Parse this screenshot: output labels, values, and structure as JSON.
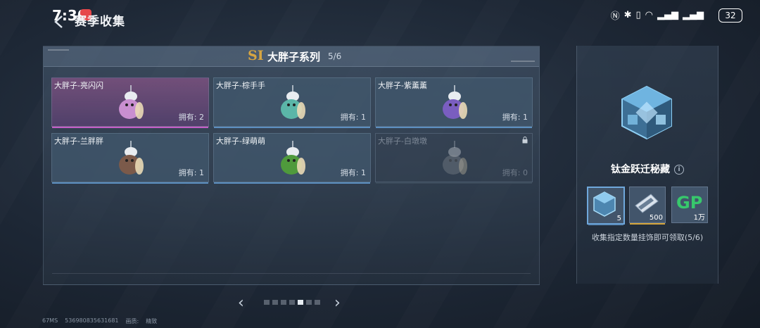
{
  "status_bar": {
    "time": "7:30",
    "battery": "32"
  },
  "header": {
    "title": "赛季收集"
  },
  "series": {
    "badge": "SI",
    "title": "大胖子系列",
    "progress": "5/6"
  },
  "cards": [
    {
      "name": "大胖子-亮闪闪",
      "owned": "拥有: 2",
      "state": "highlight",
      "color": "#c98fd0"
    },
    {
      "name": "大胖子-棕手手",
      "owned": "拥有: 1",
      "state": "normal",
      "color": "#5bb6a8"
    },
    {
      "name": "大胖子-紫薰薰",
      "owned": "拥有: 1",
      "state": "normal",
      "color": "#7a5ec0"
    },
    {
      "name": "大胖子-兰胖胖",
      "owned": "拥有: 1",
      "state": "normal",
      "color": "#7b5a4a"
    },
    {
      "name": "大胖子-绿萌萌",
      "owned": "拥有: 1",
      "state": "normal",
      "color": "#4f9a3c"
    },
    {
      "name": "大胖子-白墩墩",
      "owned": "拥有: 0",
      "state": "locked",
      "color": "#8a8f96"
    }
  ],
  "reward": {
    "name": "钛金跃迁秘藏",
    "items": [
      {
        "icon": "cube-icon",
        "qty": "5"
      },
      {
        "icon": "ticket-icon",
        "qty": "500"
      },
      {
        "icon": "gp-icon",
        "label": "GP",
        "qty": "1万"
      }
    ],
    "description": "收集指定数量挂饰即可领取(5/6)"
  },
  "pagination": {
    "total": 7,
    "active_index": 4
  },
  "footer": {
    "ping": "67MS",
    "id": "536980835631681",
    "quality_label": "画质:",
    "quality": "精致"
  }
}
